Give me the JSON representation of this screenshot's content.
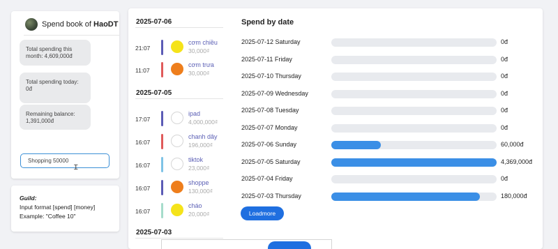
{
  "sidebar": {
    "title_prefix": "Spend book of ",
    "owner": "HaoDT",
    "stats": [
      {
        "label": "Total spending this month: 4,609,000đ"
      },
      {
        "label": "Total spending today: 0đ"
      },
      {
        "label": "Remaining balance: 1,391,000đ"
      }
    ],
    "input_value": "Shopping 50000"
  },
  "guild": {
    "heading": "Guild:",
    "line1": "Input format [spend] [money]",
    "line2": "Example: \"Coffee 10\""
  },
  "transactions": [
    {
      "date": "2025-07-06",
      "items": [
        {
          "time": "21:07",
          "name": "cơm chiều",
          "amount": "30,000₫",
          "bar_color": "#5b5bb5",
          "circle_color": "#f5e31a"
        },
        {
          "time": "11:07",
          "name": "cơm trưa",
          "amount": "30,000₫",
          "bar_color": "#e05a5a",
          "circle_color": "#ee7e1c"
        }
      ]
    },
    {
      "date": "2025-07-05",
      "items": [
        {
          "time": "17:07",
          "name": "ipad",
          "amount": "4,000,000₫",
          "bar_color": "#5b5bb5",
          "circle_color": "#ffffff"
        },
        {
          "time": "16:07",
          "name": "chanh dây",
          "amount": "196,000₫",
          "bar_color": "#e05a5a",
          "circle_color": "#ffffff"
        },
        {
          "time": "16:07",
          "name": "tiktok",
          "amount": "23,000₫",
          "bar_color": "#7ec3e6",
          "circle_color": "#ffffff"
        },
        {
          "time": "16:07",
          "name": "shoppe",
          "amount": "130,000₫",
          "bar_color": "#5b5bb5",
          "circle_color": "#ee7e1c"
        },
        {
          "time": "16:07",
          "name": "cháo",
          "amount": "20,000₫",
          "bar_color": "#a6dccb",
          "circle_color": "#f5e31a"
        }
      ]
    },
    {
      "date": "2025-07-03",
      "items": []
    }
  ],
  "chart_data": {
    "type": "bar",
    "title": "Spend by date",
    "max_value": 4369000,
    "categories": [
      "2025-07-12 Saturday",
      "2025-07-11 Friday",
      "2025-07-10 Thursday",
      "2025-07-09 Wednesday",
      "2025-07-08 Tuesday",
      "2025-07-07 Monday",
      "2025-07-06 Sunday",
      "2025-07-05 Saturday",
      "2025-07-04 Friday",
      "2025-07-03 Thursday"
    ],
    "values": [
      0,
      0,
      0,
      0,
      0,
      0,
      60000,
      4369000,
      0,
      180000
    ],
    "value_labels": [
      "0đ",
      "0đ",
      "0đ",
      "0đ",
      "0đ",
      "0đ",
      "60,000đ",
      "4,369,000đ",
      "0đ",
      "180,000đ"
    ],
    "fill_fractions": [
      0,
      0,
      0,
      0,
      0,
      0,
      0.3,
      1.0,
      0,
      0.9
    ],
    "bar_color": "#3b8fe6"
  },
  "loadmore_label": "Loadmore"
}
